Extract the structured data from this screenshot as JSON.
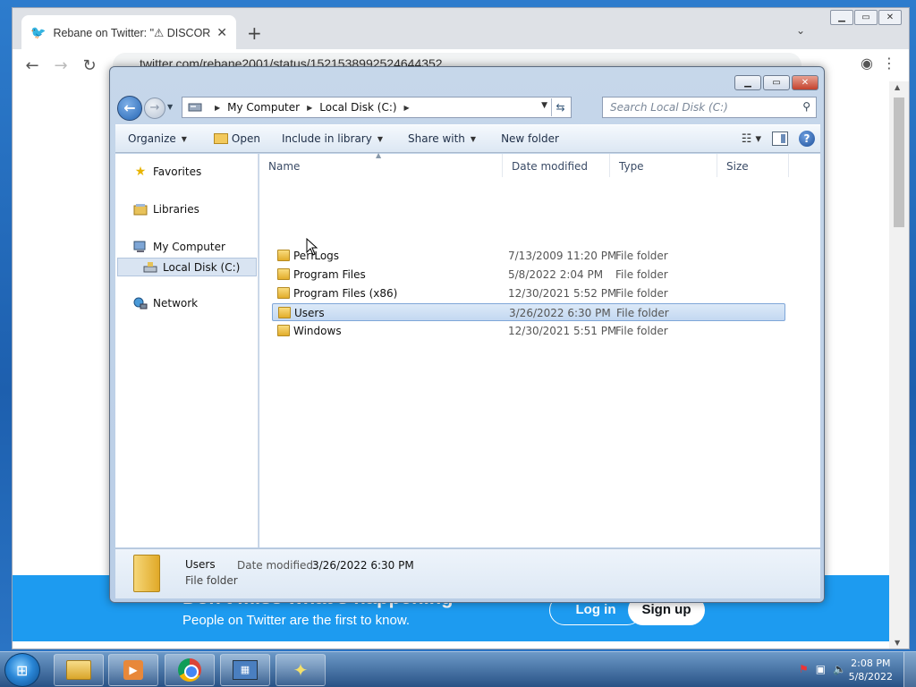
{
  "browser": {
    "tab_title": "Rebane on Twitter: \"⚠ DISCORD",
    "tab_close": "✕",
    "new_tab": "+",
    "url": "twitter.com/rebane2001/status/1521538992524644352",
    "banner_title": "Don't miss what's happening",
    "banner_subtitle": "People on Twitter are the first to know.",
    "login_label": "Log in",
    "signup_label": "Sign up"
  },
  "explorer": {
    "breadcrumb": [
      "My Computer",
      "Local Disk (C:)"
    ],
    "search_placeholder": "Search Local Disk (C:)",
    "commands": {
      "organize": "Organize",
      "open": "Open",
      "include_in_library": "Include in library",
      "share_with": "Share with",
      "new_folder": "New folder"
    },
    "nav": {
      "favorites": "Favorites",
      "libraries": "Libraries",
      "my_computer": "My Computer",
      "local_disk": "Local Disk (C:)",
      "network": "Network"
    },
    "columns": {
      "name": "Name",
      "date_modified": "Date modified",
      "type": "Type",
      "size": "Size"
    },
    "files": [
      {
        "name": "PerfLogs",
        "date": "7/13/2009 11:20 PM",
        "type": "File folder"
      },
      {
        "name": "Program Files",
        "date": "5/8/2022 2:04 PM",
        "type": "File folder"
      },
      {
        "name": "Program Files (x86)",
        "date": "12/30/2021 5:52 PM",
        "type": "File folder"
      },
      {
        "name": "Users",
        "date": "3/26/2022 6:30 PM",
        "type": "File folder"
      },
      {
        "name": "Windows",
        "date": "12/30/2021 5:51 PM",
        "type": "File folder"
      }
    ],
    "selected_file": "Users",
    "details": {
      "name": "Users",
      "type": "File folder",
      "date_label": "Date modified:",
      "date_value": "3/26/2022 6:30 PM"
    }
  },
  "taskbar": {
    "time": "2:08 PM",
    "date": "5/8/2022"
  }
}
